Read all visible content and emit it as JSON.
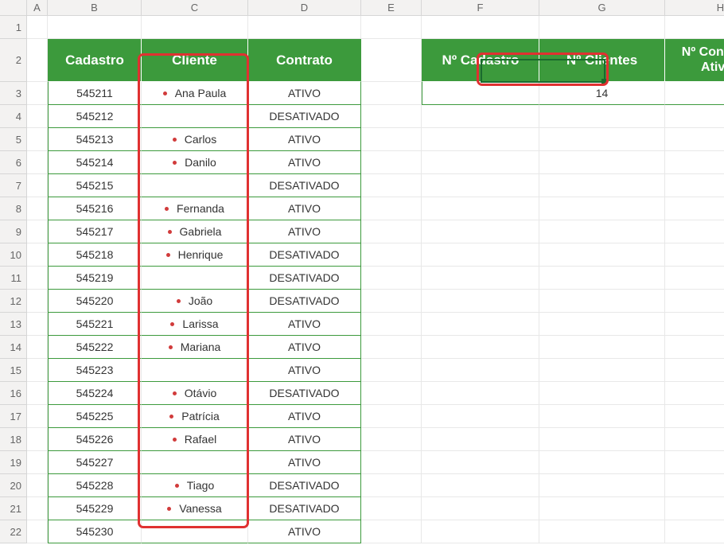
{
  "cols": [
    "A",
    "B",
    "C",
    "D",
    "E",
    "F",
    "G",
    "H"
  ],
  "rows": [
    "1",
    "2",
    "3",
    "4",
    "5",
    "6",
    "7",
    "8",
    "9",
    "10",
    "11",
    "12",
    "13",
    "14",
    "15",
    "16",
    "17",
    "18",
    "19",
    "20",
    "21",
    "22"
  ],
  "left": {
    "headers": {
      "cadastro": "Cadastro",
      "cliente": "Cliente",
      "contrato": "Contrato"
    },
    "data": [
      {
        "cadastro": "545211",
        "cliente": "Ana Paula",
        "contrato": "ATIVO"
      },
      {
        "cadastro": "545212",
        "cliente": "",
        "contrato": "DESATIVADO"
      },
      {
        "cadastro": "545213",
        "cliente": "Carlos",
        "contrato": "ATIVO"
      },
      {
        "cadastro": "545214",
        "cliente": "Danilo",
        "contrato": "ATIVO"
      },
      {
        "cadastro": "545215",
        "cliente": "",
        "contrato": "DESATIVADO"
      },
      {
        "cadastro": "545216",
        "cliente": "Fernanda",
        "contrato": "ATIVO"
      },
      {
        "cadastro": "545217",
        "cliente": "Gabriela",
        "contrato": "ATIVO"
      },
      {
        "cadastro": "545218",
        "cliente": "Henrique",
        "contrato": "DESATIVADO"
      },
      {
        "cadastro": "545219",
        "cliente": "",
        "contrato": "DESATIVADO"
      },
      {
        "cadastro": "545220",
        "cliente": "João",
        "contrato": "DESATIVADO"
      },
      {
        "cadastro": "545221",
        "cliente": "Larissa",
        "contrato": "ATIVO"
      },
      {
        "cadastro": "545222",
        "cliente": "Mariana",
        "contrato": "ATIVO"
      },
      {
        "cadastro": "545223",
        "cliente": "",
        "contrato": "ATIVO"
      },
      {
        "cadastro": "545224",
        "cliente": "Otávio",
        "contrato": "DESATIVADO"
      },
      {
        "cadastro": "545225",
        "cliente": "Patrícia",
        "contrato": "ATIVO"
      },
      {
        "cadastro": "545226",
        "cliente": "Rafael",
        "contrato": "ATIVO"
      },
      {
        "cadastro": "545227",
        "cliente": "",
        "contrato": "ATIVO"
      },
      {
        "cadastro": "545228",
        "cliente": "Tiago",
        "contrato": "DESATIVADO"
      },
      {
        "cadastro": "545229",
        "cliente": "Vanessa",
        "contrato": "DESATIVADO"
      },
      {
        "cadastro": "545230",
        "cliente": "",
        "contrato": "ATIVO"
      }
    ]
  },
  "right": {
    "headers": {
      "nCadastro": "Nº Cadastro",
      "nClientes": "Nº Clientes",
      "nContratos": "Nº Contratos Ativos"
    },
    "values": {
      "nCadastro": "",
      "nClientes": "14",
      "nContratos": ""
    }
  },
  "colors": {
    "accent": "#3c9a3c",
    "highlight": "#e03131"
  },
  "active_cell": "G3"
}
